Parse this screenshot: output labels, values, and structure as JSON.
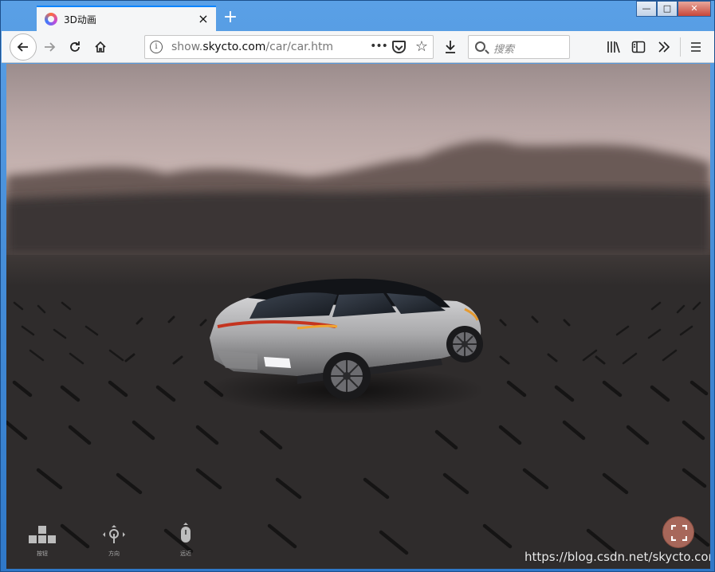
{
  "window": {
    "tab_title": "3D动画",
    "tab_close_glyph": "×",
    "new_tab_glyph": "+",
    "controls": {
      "minimize": "—",
      "maximize": "□",
      "close": "✕"
    }
  },
  "toolbar": {
    "url_prefix": "show.",
    "url_domain": "skycto.com",
    "url_path": "/car/car.htm",
    "url_more": "•••",
    "search_placeholder": "搜索",
    "icons": [
      "back-icon",
      "forward-icon",
      "reload-icon",
      "home-icon",
      "download-icon",
      "library-icon",
      "sidebar-icon",
      "overflow-icon",
      "menu-icon"
    ]
  },
  "scene": {
    "hud": [
      {
        "label": "按钮"
      },
      {
        "label": "方向"
      },
      {
        "label": "远近"
      }
    ],
    "watermark": "https://blog.csdn.net/skycto.com",
    "colors": {
      "fullscreen_button": "#a7675a",
      "tab_accent": "#0a84ff",
      "car_body": "#b9b9bb"
    }
  }
}
